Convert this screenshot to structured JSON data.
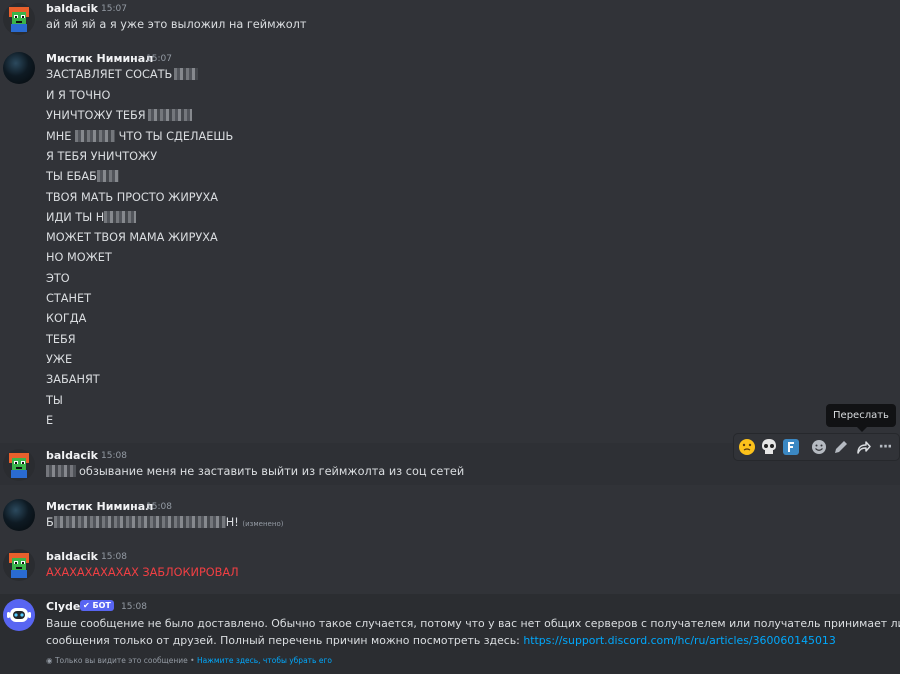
{
  "messages": [
    {
      "author": "baldacik",
      "time": "15:07",
      "lines": [
        "ай яй яй а я уже это выложил на геймжолт"
      ]
    },
    {
      "author": "Мистик Ниминал",
      "time": "15:07",
      "lines": [
        "ЗАСТАВЛЯЕТ СОСАТЬ",
        "И Я ТОЧНО",
        "УНИЧТОЖУ ТЕБЯ",
        "МНЕ",
        "ЧТО ТЫ СДЕЛАЕШЬ",
        "Я ТЕБЯ УНИЧТОЖУ",
        "ТЫ ЕБАБ",
        "ТВОЯ МАТЬ ПРОСТО ЖИРУХА",
        "ИДИ ТЫ Н",
        "МОЖЕТ ТВОЯ МАМА ЖИРУХА",
        "НО МОЖЕТ",
        "ЭТО",
        "СТАНЕТ",
        "КОГДА",
        "ТЕБЯ",
        "УЖЕ",
        "ЗАБАНЯТ",
        "ТЫ",
        "Е"
      ]
    },
    {
      "author": "baldacik",
      "time": "15:08",
      "text": "обзывание меня не заставить выйти из геймжолта из соц сетей"
    },
    {
      "author": "Мистик Ниминал",
      "time": "15:08",
      "prefix": "Б",
      "suffix": "Н!",
      "edited": "(изменено)"
    },
    {
      "author": "baldacik",
      "time": "15:08",
      "text": "АХАХАХАХАХАХ ЗАБЛОКИРОВАЛ"
    },
    {
      "author": "Clyde",
      "badge": "✔ БОТ",
      "time": "15:08",
      "line1": "Ваше сообщение не было доставлено. Обычно такое случается, потому что у вас нет общих серверов с получателем или получатель принимает личные",
      "line2": "сообщения только от друзей. Полный перечень причин можно посмотреть здесь:",
      "link": "https://support.discord.com/hc/ru/articles/360060145013",
      "notice": "Только вы видите это сообщение •",
      "dismiss": "Нажмите здесь, чтобы убрать его"
    }
  ],
  "toolbar": {
    "tooltip": "Переслать",
    "icons": [
      "thinking-emoji",
      "skull-emoji",
      "f-emoji",
      "add-reaction-icon",
      "edit-icon",
      "forward-icon",
      "more-icon"
    ],
    "more_glyph": "···"
  },
  "colors": {
    "background": "#313338",
    "link": "#00a8fc",
    "danger": "#f23f43",
    "brand": "#5865f2"
  }
}
